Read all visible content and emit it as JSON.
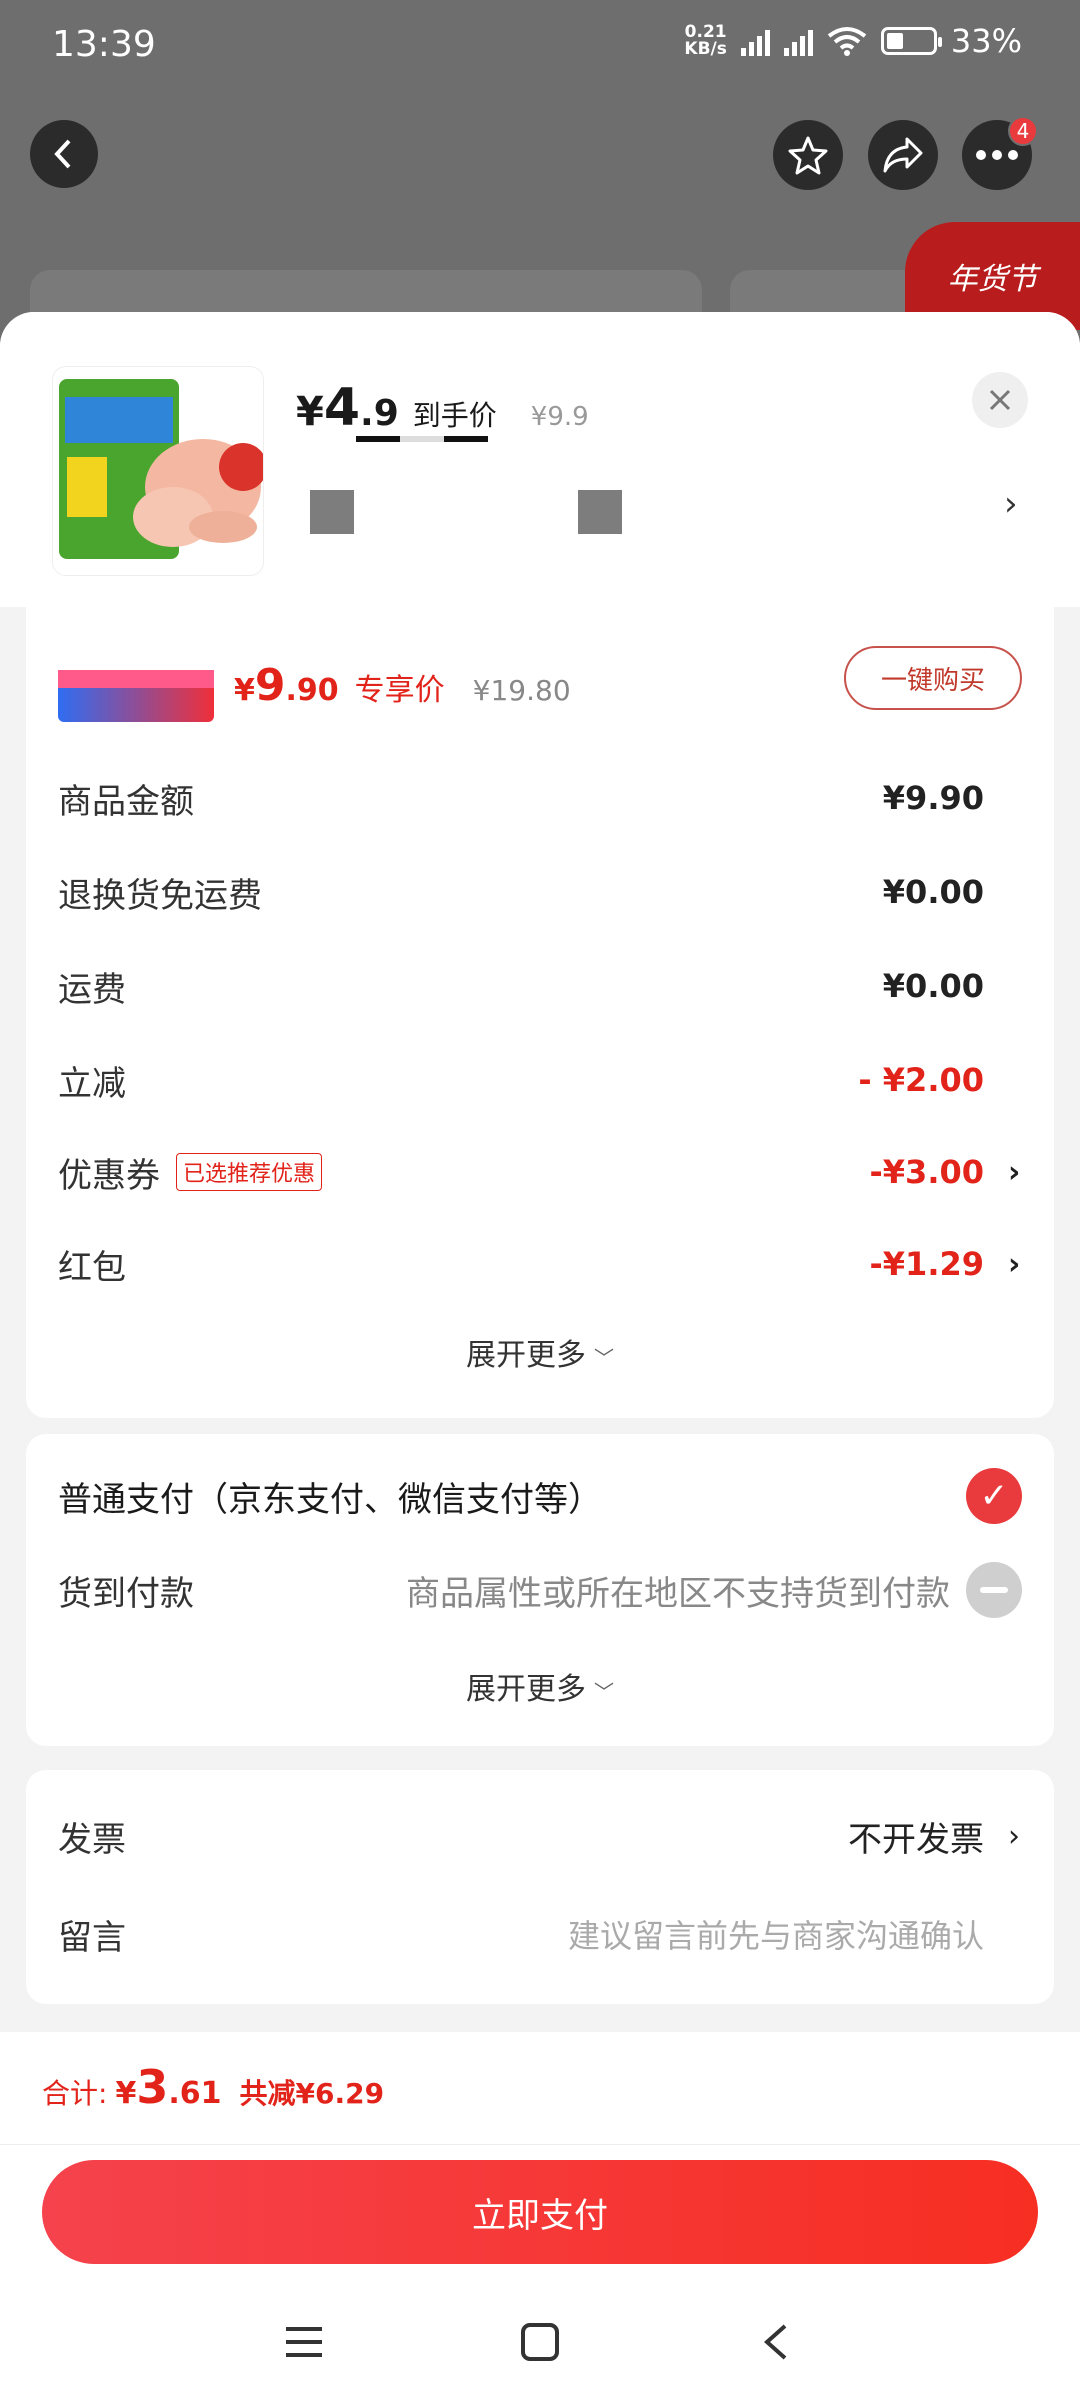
{
  "status_bar": {
    "time": "13:39",
    "net_speed_top": "0.21",
    "net_speed_bottom": "KB/s",
    "battery": "33%",
    "battery_level_percent": 33
  },
  "top_nav": {
    "icons": {
      "back": "back-icon",
      "favorite": "star-icon",
      "share": "share-icon",
      "more": "more-icon"
    },
    "more_badge": "4",
    "promo_tag": "年货节"
  },
  "product": {
    "price_symbol": "¥",
    "price_int": "4",
    "price_dec": ".9",
    "price_label": "到手价",
    "original_price": "¥9.9"
  },
  "deal": {
    "price_symbol": "¥",
    "price_int": "9",
    "price_dec": ".90",
    "tag": "专享价",
    "original_price": "¥19.80",
    "buy_button": "一键购买"
  },
  "summary": {
    "rows": [
      {
        "label": "商品金额",
        "value": "¥9.90"
      },
      {
        "label": "退换货免运费",
        "value": "¥0.00"
      },
      {
        "label": "运费",
        "value": "¥0.00"
      },
      {
        "label": "立减",
        "value": "- ¥2.00"
      },
      {
        "label": "优惠券",
        "chip": "已选推荐优惠",
        "value": "-¥3.00"
      },
      {
        "label": "红包",
        "value": "-¥1.29"
      }
    ],
    "expand": "展开更多"
  },
  "payment": {
    "normal_label": "普通支付（京东支付、微信支付等）",
    "cod_label": "货到付款",
    "cod_note": "商品属性或所在地区不支持货到付款",
    "expand": "展开更多"
  },
  "invoice": {
    "label": "发票",
    "value": "不开发票",
    "message_label": "留言",
    "message_placeholder": "建议留言前先与商家沟通确认"
  },
  "footer": {
    "total_label": "合计:",
    "total_symbol": "¥",
    "total_int": "3",
    "total_dec": ".61",
    "saved": "共减¥6.29",
    "pay_button": "立即支付"
  },
  "colors": {
    "accent": "#e2231a",
    "button_gradient_start": "#f5424c",
    "button_gradient_end": "#f72e22"
  }
}
